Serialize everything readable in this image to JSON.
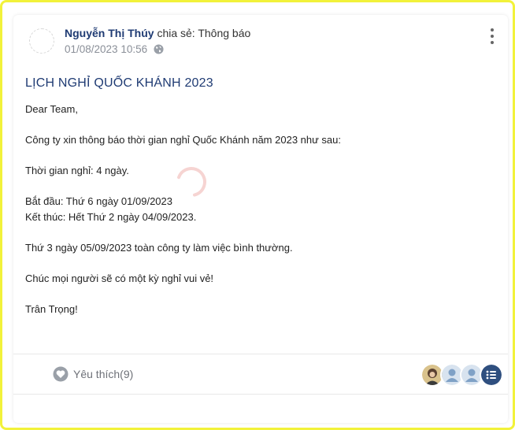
{
  "post": {
    "author": "Nguyễn Thị Thúy",
    "share_text": "chia sẻ: Thông báo",
    "date": "01/08/2023 10:56",
    "title": "LỊCH NGHỈ QUỐC KHÁNH 2023",
    "lines": [
      "Dear Team,",
      "",
      "Công ty xin thông báo thời gian nghỉ Quốc Khánh năm 2023 như sau:",
      "",
      "Thời gian nghỉ: 4 ngày.",
      "",
      "Bắt đầu: Thứ 6 ngày 01/09/2023",
      "Kết thúc: Hết Thứ 2 ngày 04/09/2023.",
      "",
      "Thứ 3 ngày 05/09/2023 toàn công ty làm việc bình thường.",
      "",
      "Chúc mọi người sẽ có một kỳ nghỉ vui vẻ!",
      "",
      "Trân Trọng!"
    ]
  },
  "footer": {
    "like_label": "Yêu thích(9)"
  },
  "colors": {
    "accent": "#1f3b73",
    "frame": "#f2f23a",
    "muted": "#8a8f98",
    "reactor": "#7fa1c6",
    "list_badge": "#2f4f7f"
  },
  "icons": [
    "more-vert-icon",
    "globe-icon",
    "heart-icon",
    "list-icon",
    "loading-spinner-icon"
  ]
}
